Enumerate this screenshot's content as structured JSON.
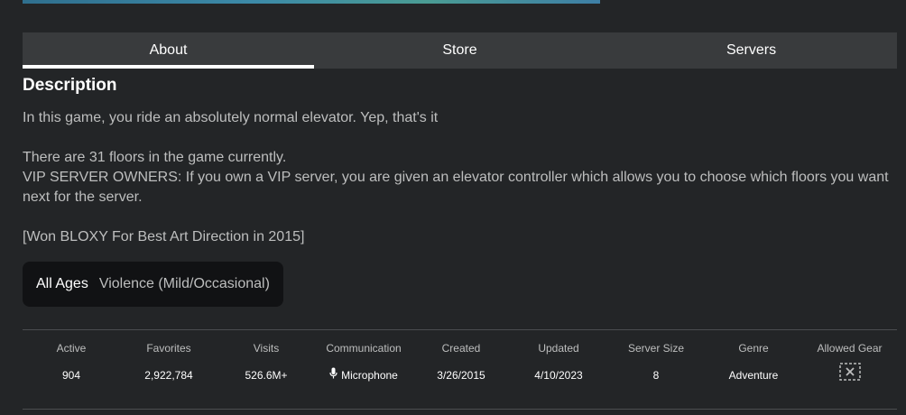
{
  "tabs": {
    "about": "About",
    "store": "Store",
    "servers": "Servers"
  },
  "description": {
    "title": "Description",
    "line1": "In this game, you ride an absolutely normal elevator. Yep, that's it",
    "line2": "There are 31 floors in the game currently.",
    "line3": "VIP SERVER OWNERS: If you own a VIP server, you are given an elevator controller which allows you to choose which floors you want next for the server.",
    "line4": "[Won BLOXY For Best Art Direction in 2015]"
  },
  "rating": {
    "age": "All Ages",
    "content": "Violence (Mild/Occasional)"
  },
  "stats": {
    "active": {
      "label": "Active",
      "value": "904"
    },
    "favorites": {
      "label": "Favorites",
      "value": "2,922,784"
    },
    "visits": {
      "label": "Visits",
      "value": "526.6M+"
    },
    "communication": {
      "label": "Communication",
      "value": "Microphone",
      "icon": "microphone-icon"
    },
    "created": {
      "label": "Created",
      "value": "3/26/2015"
    },
    "updated": {
      "label": "Updated",
      "value": "4/10/2023"
    },
    "server_size": {
      "label": "Server Size",
      "value": "8"
    },
    "genre": {
      "label": "Genre",
      "value": "Adventure"
    },
    "allowed_gear": {
      "label": "Allowed Gear",
      "icon": "no-gear-icon"
    }
  },
  "colors": {
    "background": "#232527",
    "tab_bar": "#393b3d",
    "rating_box": "#111214",
    "active_tab_indicator": "#ffffff"
  }
}
